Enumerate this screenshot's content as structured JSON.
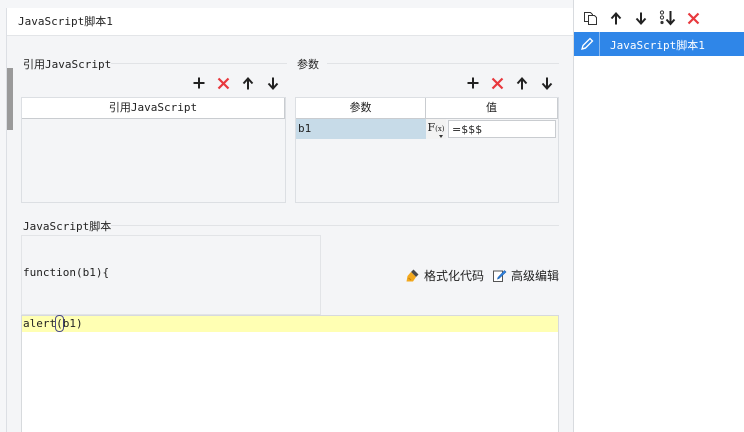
{
  "dialog": {
    "title": "JavaScript脚本1"
  },
  "ref_section": {
    "title": "引用JavaScript",
    "column_header": "引用JavaScript",
    "toolbar_icons": [
      "plus-icon",
      "delete-icon",
      "arrow-up-icon",
      "arrow-down-icon"
    ]
  },
  "params_section": {
    "title": "参数",
    "columns": [
      "参数",
      "值"
    ],
    "rows": [
      {
        "name": "b1",
        "formula_label": "F",
        "formula_sub": "(x)",
        "value": "=$$$"
      }
    ],
    "toolbar_icons": [
      "plus-icon",
      "delete-icon",
      "arrow-up-icon",
      "arrow-down-icon"
    ]
  },
  "script_section": {
    "title": "JavaScript脚本",
    "function_signature": "function(b1){",
    "format_button": "格式化代码",
    "advanced_button": "高级编辑",
    "code": {
      "before": "alert",
      "paren": "(",
      "after": "b1)"
    }
  },
  "right_panel": {
    "toolbar_icons": [
      "copy-icon",
      "arrow-up-icon",
      "arrow-down-icon",
      "move-bottom-icon",
      "delete-icon"
    ],
    "items": [
      {
        "label": "JavaScript脚本1",
        "selected": true
      }
    ]
  },
  "colors": {
    "accent": "#2f86e8",
    "delete": "#e8383d",
    "param_highlight": "#c7dbe8",
    "code_line_highlight": "#ffffb3"
  }
}
